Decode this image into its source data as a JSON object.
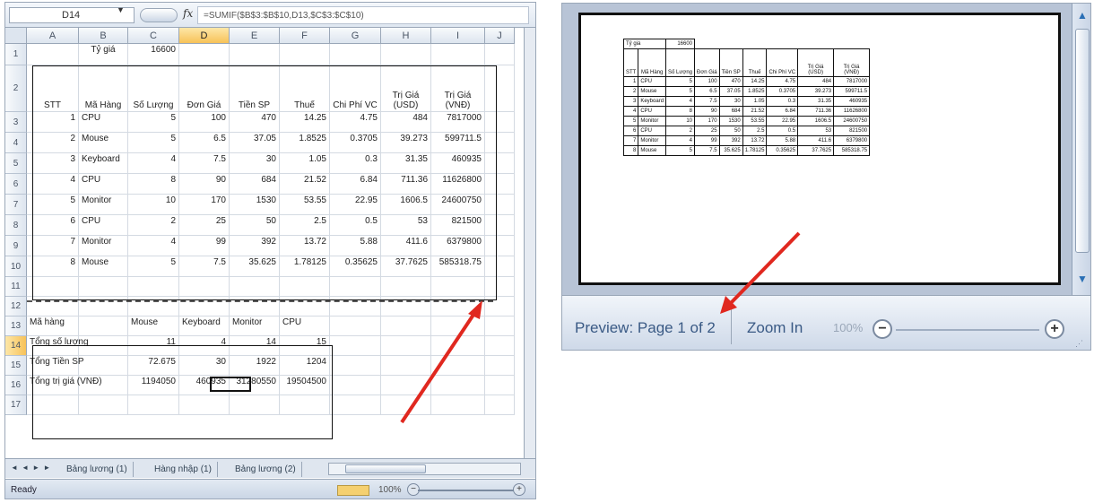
{
  "excel": {
    "formula_bar": {
      "name_box": "D14",
      "fx": "fx",
      "formula": "=SUMIF($B$3:$B$10,D13,$C$3:$C$10)"
    },
    "columns": [
      "A",
      "B",
      "C",
      "D",
      "E",
      "F",
      "G",
      "H",
      "I",
      "J"
    ],
    "rows": [
      "1",
      "2",
      "3",
      "4",
      "5",
      "6",
      "7",
      "8",
      "9",
      "10",
      "11",
      "12",
      "13",
      "14",
      "15",
      "16",
      "17"
    ],
    "rate": {
      "label": "Tỷ giá",
      "value": "16600"
    },
    "headers": [
      "STT",
      "Mã Hàng",
      "Số Lượng",
      "Đơn Giá",
      "Tiền SP",
      "Thuế",
      "Chi Phí VC",
      "Trị Giá (USD)",
      "Trị Giá (VNĐ)"
    ],
    "data_rows": [
      [
        "1",
        "CPU",
        "5",
        "100",
        "470",
        "14.25",
        "4.75",
        "484",
        "7817000"
      ],
      [
        "2",
        "Mouse",
        "5",
        "6.5",
        "37.05",
        "1.8525",
        "0.3705",
        "39.273",
        "599711.5"
      ],
      [
        "3",
        "Keyboard",
        "4",
        "7.5",
        "30",
        "1.05",
        "0.3",
        "31.35",
        "460935"
      ],
      [
        "4",
        "CPU",
        "8",
        "90",
        "684",
        "21.52",
        "6.84",
        "711.36",
        "11626800"
      ],
      [
        "5",
        "Monitor",
        "10",
        "170",
        "1530",
        "53.55",
        "22.95",
        "1606.5",
        "24600750"
      ],
      [
        "6",
        "CPU",
        "2",
        "25",
        "50",
        "2.5",
        "0.5",
        "53",
        "821500"
      ],
      [
        "7",
        "Monitor",
        "4",
        "99",
        "392",
        "13.72",
        "5.88",
        "411.6",
        "6379800"
      ],
      [
        "8",
        "Mouse",
        "5",
        "7.5",
        "35.625",
        "1.78125",
        "0.35625",
        "37.7625",
        "585318.75"
      ]
    ],
    "summary": {
      "header": [
        "Mã hàng",
        "Mouse",
        "Keyboard",
        "Monitor",
        "CPU"
      ],
      "rows": [
        [
          "Tổng số lượng",
          "11",
          "4",
          "14",
          "15"
        ],
        [
          "Tổng Tiền SP",
          "72.675",
          "30",
          "1922",
          "1204"
        ],
        [
          "Tổng trị giá (VNĐ)",
          "1194050",
          "460935",
          "31280550",
          "19504500"
        ]
      ]
    },
    "sheet_nav": "◄ ◄ ► ►",
    "sheet_tabs": [
      "Bảng lương (1)",
      "Hàng nhập (1)",
      "Bảng lương (2)"
    ],
    "status": {
      "ready": "Ready",
      "zoom": "100%",
      "minus": "−",
      "plus": "+"
    }
  },
  "preview": {
    "rate": {
      "label": "Tỷ giá",
      "value": "16600"
    },
    "headers": [
      "STT",
      "Mã Hàng",
      "Số Lượng",
      "Đơn Giá",
      "Tiền SP",
      "Thuế",
      "Chi Phí VC",
      "Trị Giá (USD)",
      "Trị Giá (VNĐ)"
    ],
    "data_rows": [
      [
        "1",
        "CPU",
        "5",
        "100",
        "470",
        "14.25",
        "4.75",
        "484",
        "7817000"
      ],
      [
        "2",
        "Mouse",
        "5",
        "6.5",
        "37.05",
        "1.8525",
        "0.3705",
        "39.273",
        "599711.5"
      ],
      [
        "3",
        "Keyboard",
        "4",
        "7.5",
        "30",
        "1.05",
        "0.3",
        "31.35",
        "460935"
      ],
      [
        "4",
        "CPU",
        "8",
        "90",
        "684",
        "21.52",
        "6.84",
        "711.36",
        "11626800"
      ],
      [
        "5",
        "Monitor",
        "10",
        "170",
        "1530",
        "53.55",
        "22.95",
        "1606.5",
        "24600750"
      ],
      [
        "6",
        "CPU",
        "2",
        "25",
        "50",
        "2.5",
        "0.5",
        "53",
        "821500"
      ],
      [
        "7",
        "Monitor",
        "4",
        "99",
        "392",
        "13.72",
        "5.88",
        "411.6",
        "6379800"
      ],
      [
        "8",
        "Mouse",
        "5",
        "7.5",
        "35.625",
        "1.78125",
        "0.35625",
        "37.7625",
        "585318.75"
      ]
    ],
    "status": {
      "page_label": "Preview: Page 1 of 2",
      "zoom_in": "Zoom In",
      "zoom_pct": "100%",
      "minus": "−",
      "plus": "+",
      "grip": "⋰"
    },
    "scroll": {
      "up": "▲",
      "down": "▼"
    }
  },
  "colors": {
    "arrow": "#e0281f",
    "selected_header": "#f7c258",
    "status_text": "#3a5a85"
  }
}
